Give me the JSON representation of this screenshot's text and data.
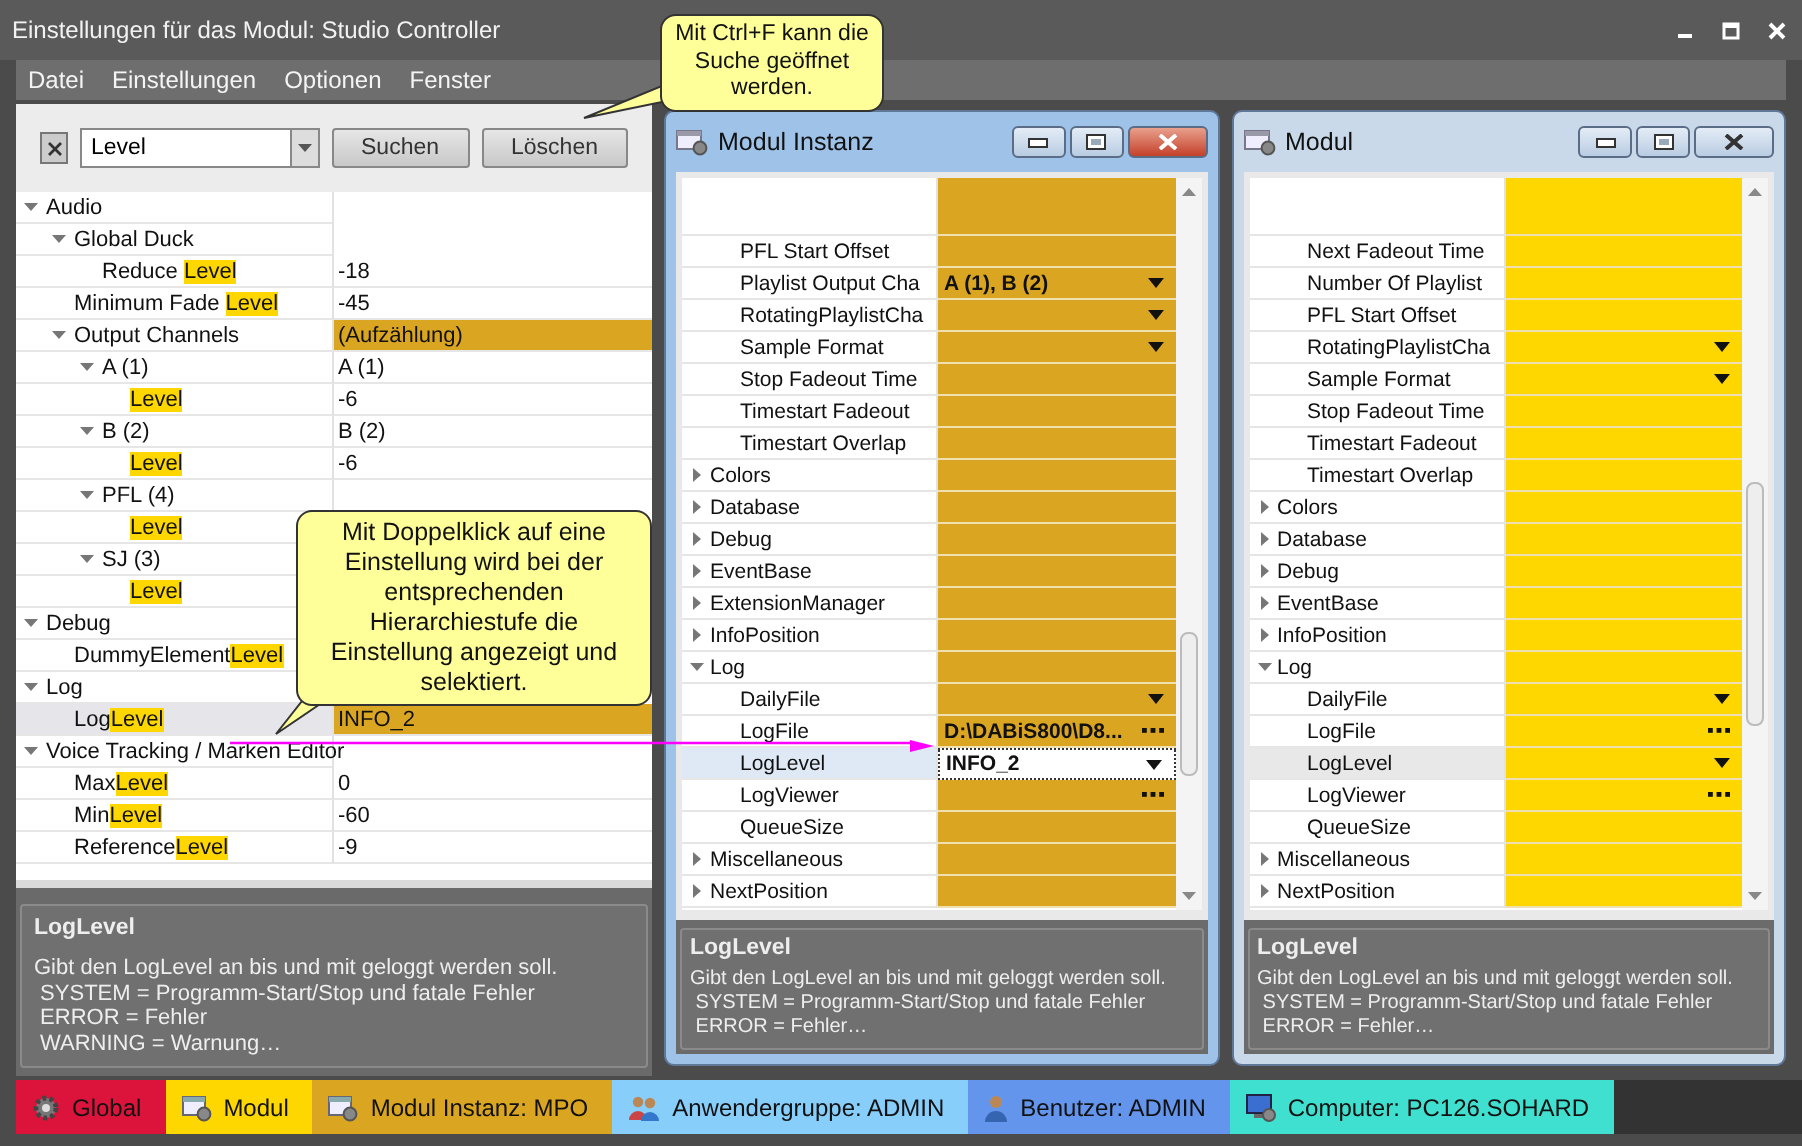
{
  "window": {
    "title": "Einstellungen für das Modul: Studio Controller"
  },
  "menu": [
    "Datei",
    "Einstellungen",
    "Optionen",
    "Fenster"
  ],
  "left_panel": {
    "search": {
      "value": "Level",
      "buttons": [
        "Suchen",
        "Löschen"
      ]
    },
    "tree": [
      {
        "label": "Audio",
        "expanded": true,
        "selected": false,
        "children": [
          {
            "label": "Global Duck",
            "expanded": true,
            "selected": false,
            "children": [
              {
                "label": "Reduce ",
                "match": "Level",
                "value": "-18",
                "highlighted": false,
                "selected": false
              }
            ]
          },
          {
            "label": "Minimum Fade ",
            "match": "Level",
            "value": "-45",
            "highlighted": false,
            "selected": false
          },
          {
            "label": "Output Channels",
            "expanded": true,
            "value": "(Aufzählung)",
            "highlighted": true,
            "selected": false,
            "children": [
              {
                "label": "A (1)",
                "expanded": true,
                "value": "A (1)",
                "highlighted": false,
                "selected": false,
                "children": [
                  {
                    "match": "Level",
                    "value": "-6",
                    "highlighted": false,
                    "selected": false
                  }
                ]
              },
              {
                "label": "B (2)",
                "expanded": true,
                "value": "B (2)",
                "highlighted": false,
                "selected": false,
                "children": [
                  {
                    "match": "Level",
                    "value": "-6",
                    "highlighted": false,
                    "selected": false
                  }
                ]
              },
              {
                "label": "PFL (4)",
                "expanded": true,
                "selected": false,
                "children": [
                  {
                    "match": "Level",
                    "selected": false
                  }
                ]
              },
              {
                "label": "SJ (3)",
                "expanded": true,
                "selected": false,
                "children": [
                  {
                    "match": "Level",
                    "selected": false
                  }
                ]
              }
            ]
          }
        ]
      },
      {
        "label": "Debug",
        "expanded": true,
        "selected": false,
        "children": [
          {
            "label": "DummyElement",
            "match": "Level",
            "selected": false
          }
        ]
      },
      {
        "label": "Log",
        "expanded": true,
        "selected": false,
        "children": [
          {
            "label": "Log",
            "match": "Level",
            "value": "INFO_2",
            "highlighted": true,
            "selected": true
          }
        ]
      },
      {
        "label": "Voice Tracking / Marken Editor",
        "expanded": true,
        "selected": false,
        "children": [
          {
            "label": "Max",
            "match": "Level",
            "value": "0",
            "highlighted": false,
            "selected": false
          },
          {
            "label": "Min",
            "match": "Level",
            "value": "-60",
            "highlighted": false,
            "selected": false
          },
          {
            "label": "Reference",
            "match": "Level",
            "value": "-9",
            "highlighted": false,
            "selected": false
          }
        ]
      }
    ],
    "description": {
      "title": "LogLevel",
      "lines": [
        "Gibt den LogLevel an bis und mit geloggt werden soll.",
        " SYSTEM = Programm-Start/Stop und fatale Fehler",
        " ERROR = Fehler",
        " WARNING = Warnung…"
      ]
    }
  },
  "windows": [
    {
      "title": "Modul Instanz",
      "active": true,
      "color": "#daa520",
      "rows": [
        {
          "kind": "group-continued",
          "children": [
            {
              "kind": "plain",
              "label": "PFL Start Offset",
              "selected": false
            },
            {
              "kind": "dropdown",
              "label": "Playlist Output Cha",
              "value": "A (1), B (2)",
              "modified": true,
              "selected": false
            },
            {
              "kind": "dropdown",
              "label": "RotatingPlaylistCha",
              "selected": false
            },
            {
              "kind": "dropdown",
              "label": "Sample Format",
              "selected": false
            },
            {
              "kind": "plain",
              "label": "Stop Fadeout Time",
              "selected": false
            },
            {
              "kind": "plain",
              "label": "Timestart Fadeout",
              "selected": false
            },
            {
              "kind": "plain",
              "label": "Timestart Overlap",
              "selected": false
            }
          ]
        },
        {
          "kind": "group",
          "label": "Colors",
          "expanded": false,
          "selected": false
        },
        {
          "kind": "group",
          "label": "Database",
          "expanded": false,
          "selected": false
        },
        {
          "kind": "group",
          "label": "Debug",
          "expanded": false,
          "selected": false
        },
        {
          "kind": "group",
          "label": "EventBase",
          "expanded": false,
          "selected": false
        },
        {
          "kind": "group",
          "label": "ExtensionManager",
          "expanded": false,
          "selected": false
        },
        {
          "kind": "group",
          "label": "InfoPosition",
          "expanded": false,
          "selected": false
        },
        {
          "kind": "group",
          "label": "Log",
          "expanded": true,
          "selected": false,
          "children": [
            {
              "kind": "dropdown",
              "label": "DailyFile",
              "selected": false
            },
            {
              "kind": "ellipsis",
              "label": "LogFile",
              "value": "D:\\DABiS800\\D8...",
              "modified": true,
              "selected": false
            },
            {
              "kind": "dropdown",
              "label": "LogLevel",
              "value": "INFO_2",
              "modified": true,
              "selected": true
            },
            {
              "kind": "ellipsis",
              "label": "LogViewer",
              "selected": false
            },
            {
              "kind": "plain",
              "label": "QueueSize",
              "selected": false
            }
          ]
        },
        {
          "kind": "group",
          "label": "Miscellaneous",
          "expanded": false,
          "selected": false
        },
        {
          "kind": "group",
          "label": "NextPosition",
          "expanded": false,
          "selected": false
        }
      ],
      "description": {
        "title": "LogLevel",
        "lines": [
          "Gibt den LogLevel an bis und mit geloggt werden soll.",
          " SYSTEM = Programm-Start/Stop und fatale Fehler",
          " ERROR = Fehler…"
        ]
      }
    },
    {
      "title": "Modul",
      "active": false,
      "color": "#ffd700",
      "rows": [
        {
          "kind": "group-continued",
          "children": [
            {
              "kind": "plain",
              "label": "Next Fadeout Time",
              "selected": false
            },
            {
              "kind": "plain",
              "label": "Number Of Playlist",
              "selected": false
            },
            {
              "kind": "plain",
              "label": "PFL Start Offset",
              "selected": false
            },
            {
              "kind": "dropdown",
              "label": "RotatingPlaylistCha",
              "selected": false
            },
            {
              "kind": "dropdown",
              "label": "Sample Format",
              "selected": false
            },
            {
              "kind": "plain",
              "label": "Stop Fadeout Time",
              "selected": false
            },
            {
              "kind": "plain",
              "label": "Timestart Fadeout",
              "selected": false
            },
            {
              "kind": "plain",
              "label": "Timestart Overlap",
              "selected": false
            }
          ]
        },
        {
          "kind": "group",
          "label": "Colors",
          "expanded": false,
          "selected": false
        },
        {
          "kind": "group",
          "label": "Database",
          "expanded": false,
          "selected": false
        },
        {
          "kind": "group",
          "label": "Debug",
          "expanded": false,
          "selected": false
        },
        {
          "kind": "group",
          "label": "EventBase",
          "expanded": false,
          "selected": false
        },
        {
          "kind": "group",
          "label": "InfoPosition",
          "expanded": false,
          "selected": false
        },
        {
          "kind": "group",
          "label": "Log",
          "expanded": true,
          "selected": false,
          "children": [
            {
              "kind": "dropdown",
              "label": "DailyFile",
              "selected": false
            },
            {
              "kind": "ellipsis",
              "label": "LogFile",
              "selected": false
            },
            {
              "kind": "dropdown",
              "label": "LogLevel",
              "selected": true
            },
            {
              "kind": "ellipsis",
              "label": "LogViewer",
              "selected": false
            },
            {
              "kind": "plain",
              "label": "QueueSize",
              "selected": false
            }
          ]
        },
        {
          "kind": "group",
          "label": "Miscellaneous",
          "expanded": false,
          "selected": false
        },
        {
          "kind": "group",
          "label": "NextPosition",
          "expanded": false,
          "selected": false
        }
      ],
      "description": {
        "title": "LogLevel",
        "lines": [
          "Gibt den LogLevel an bis und mit geloggt werden soll.",
          " SYSTEM = Programm-Start/Stop und fatale Fehler",
          " ERROR = Fehler…"
        ]
      }
    }
  ],
  "callouts": [
    {
      "text": "Mit Ctrl+F kann die Suche geöffnet werden."
    },
    {
      "text": "Mit Doppelklick auf eine Einstellung wird bei der entsprechenden Hierarchiestufe die Einstellung angezeigt und selektiert."
    }
  ],
  "status_bar": [
    {
      "kind": "global",
      "label": "Global",
      "color": "#dc143c"
    },
    {
      "kind": "module",
      "label": "Modul",
      "color": "#ffd700"
    },
    {
      "kind": "module",
      "label": "Modul Instanz: MPO",
      "color": "#daa520"
    },
    {
      "kind": "group",
      "label": "Anwendergruppe: ADMIN",
      "color": "#87cefa"
    },
    {
      "kind": "user",
      "label": "Benutzer: ADMIN",
      "color": "#6495ed"
    },
    {
      "kind": "computer",
      "label": "Computer: PC126.SOHARD",
      "color": "#40e0d0"
    }
  ]
}
